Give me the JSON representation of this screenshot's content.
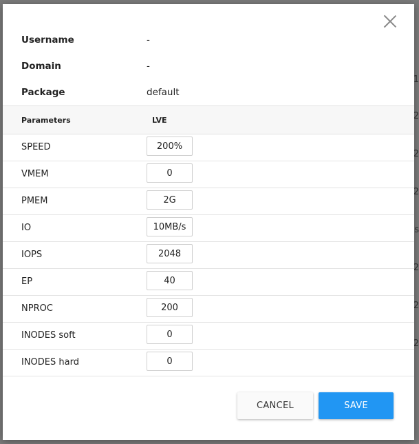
{
  "backdrop": {
    "fragments": [
      "1",
      "2",
      "2",
      "2",
      "s",
      "2",
      "2",
      "2"
    ]
  },
  "dialog": {
    "info": [
      {
        "label": "Username",
        "value": "-"
      },
      {
        "label": "Domain",
        "value": "-"
      },
      {
        "label": "Package",
        "value": "default"
      }
    ],
    "table": {
      "headers": {
        "parameters": "Parameters",
        "lve": "LVE"
      },
      "rows": [
        {
          "label": "SPEED",
          "value": "200%"
        },
        {
          "label": "VMEM",
          "value": "0"
        },
        {
          "label": "PMEM",
          "value": "2G"
        },
        {
          "label": "IO",
          "value": "10MB/s"
        },
        {
          "label": "IOPS",
          "value": "2048"
        },
        {
          "label": "EP",
          "value": "40"
        },
        {
          "label": "NPROC",
          "value": "200"
        },
        {
          "label": "INODES soft",
          "value": "0"
        },
        {
          "label": "INODES hard",
          "value": "0"
        }
      ]
    },
    "buttons": {
      "cancel": "CANCEL",
      "save": "SAVE"
    },
    "colors": {
      "primary": "#2196f3"
    }
  }
}
